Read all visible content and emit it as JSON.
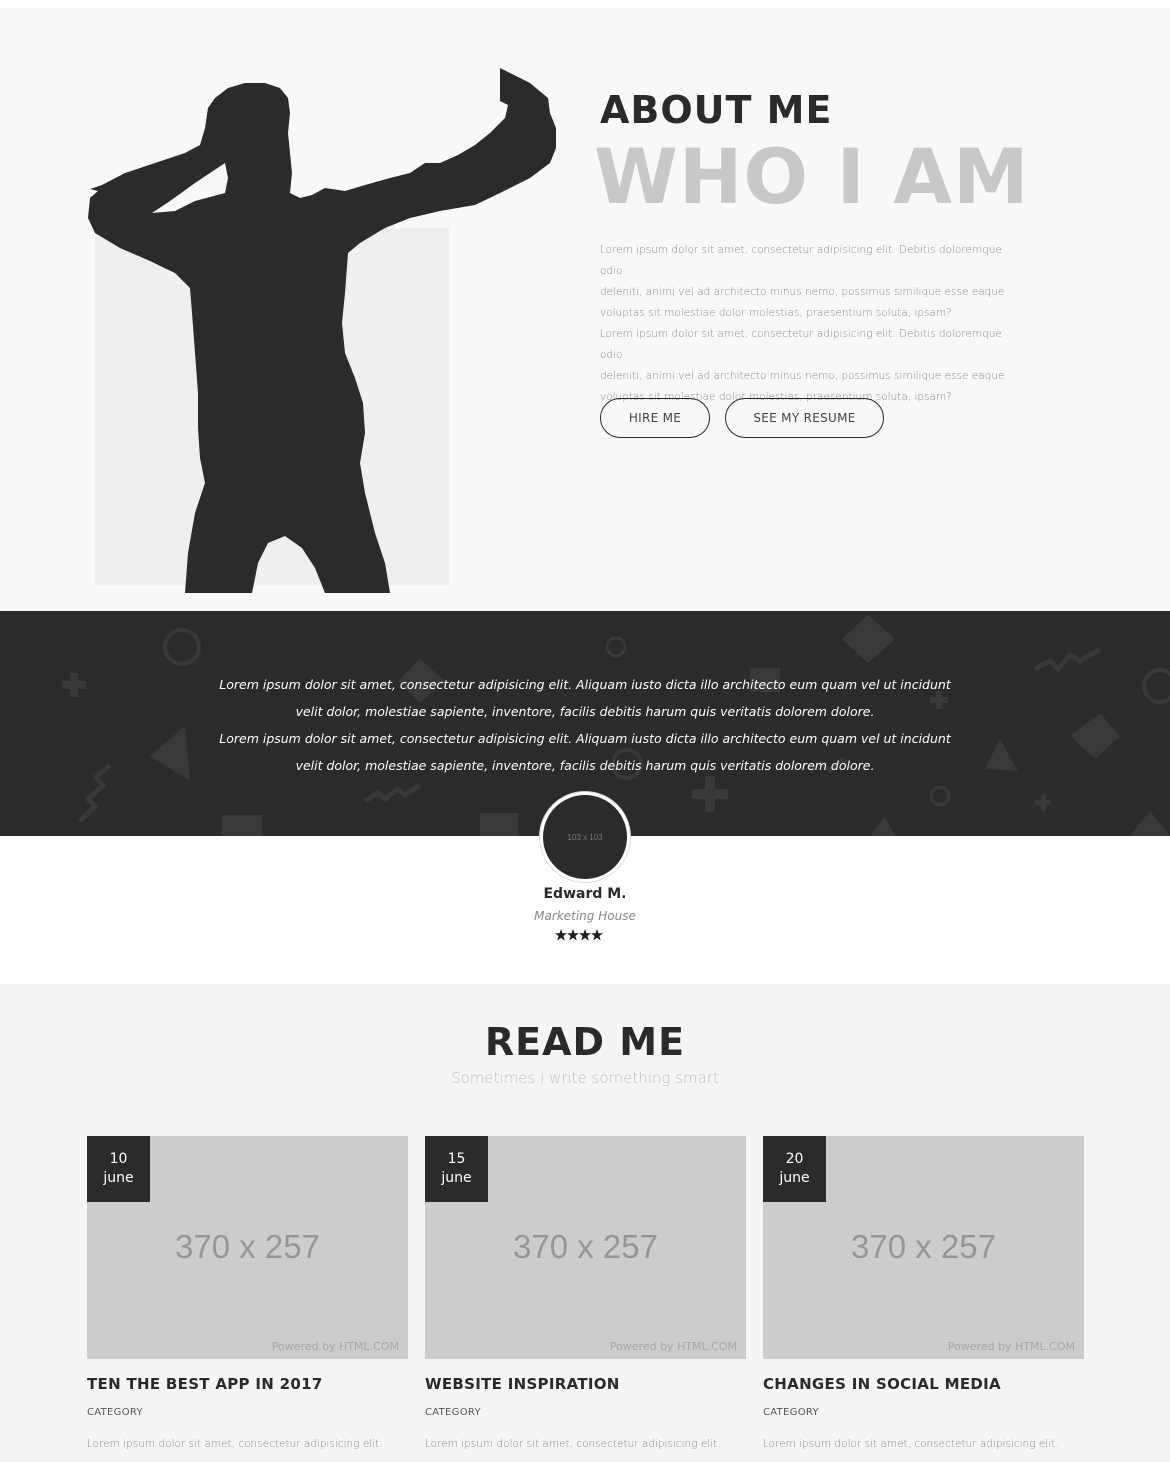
{
  "about": {
    "kicker": "ABOUT ME",
    "title": "WHO I AM",
    "paragraphs": [
      "Lorem ipsum dolor sit amet, consectetur adipisicing elit. Debitis doloremque odio",
      "deleniti, animi vel ad architecto minus nemo, possimus similique esse eaque",
      "voluptas sit molestiae dolor molestias, praesentium soluta, ipsam?",
      "Lorem ipsum dolor sit amet, consectetur adipisicing elit. Debitis doloremque odio",
      "deleniti, animi vel ad architecto minus nemo, possimus similique esse eaque",
      "voluptas sit molestiae dolor molestias, praesentium soluta, ipsam?"
    ],
    "hire_label": "HIRE ME",
    "resume_label": "SEE MY RESUME"
  },
  "testimonial": {
    "lines": [
      "Lorem ipsum dolor sit amet, consectetur adipisicing elit. Aliquam iusto dicta illo architecto eum quam vel ut incidunt",
      "velit dolor, molestiae sapiente, inventore, facilis debitis harum quis veritatis dolorem dolore.",
      "Lorem ipsum dolor sit amet, consectetur adipisicing elit. Aliquam iusto dicta illo architecto eum quam vel ut incidunt",
      "velit dolor, molestiae sapiente, inventore, facilis debitis harum quis veritatis dolorem dolore."
    ],
    "avatar_placeholder": "103 x 103",
    "name": "Edward M.",
    "company": "Marketing House",
    "rating": 4.5,
    "rating_max": 5
  },
  "read": {
    "title": "READ ME",
    "subtitle": "Sometimes i write something smart",
    "posts": [
      {
        "day": "10",
        "month": "june",
        "image_placeholder": "370 x 257",
        "powered": "Powered by HTML.COM",
        "title": "TEN THE BEST APP IN 2017",
        "category": "CATEGORY",
        "excerpt": "Lorem ipsum dolor sit amet, consectetur adipisicing elit."
      },
      {
        "day": "15",
        "month": "june",
        "image_placeholder": "370 x 257",
        "powered": "Powered by HTML.COM",
        "title": "WEBSITE INSPIRATION",
        "category": "CATEGORY",
        "excerpt": "Lorem ipsum dolor sit amet, consectetur adipisicing elit."
      },
      {
        "day": "20",
        "month": "june",
        "image_placeholder": "370 x 257",
        "powered": "Powered by HTML.COM",
        "title": "CHANGES IN SOCIAL MEDIA",
        "category": "CATEGORY",
        "excerpt": "Lorem ipsum dolor sit amet, consectetur adipisicing elit."
      }
    ]
  },
  "colors": {
    "dark": "#2d2a2b",
    "light_bg": "#f8f8f8",
    "title_gray": "#c8c8c8",
    "placeholder_gray": "#cccccc"
  }
}
